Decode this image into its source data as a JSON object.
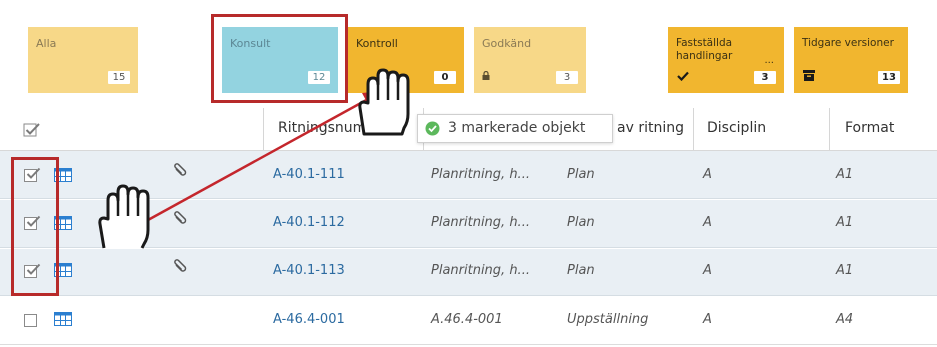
{
  "tiles": {
    "alla": {
      "label": "Alla",
      "count": "15"
    },
    "konsult": {
      "label": "Konsult",
      "count": "12"
    },
    "kontroll": {
      "label": "Kontroll",
      "count": "0"
    },
    "godkand": {
      "label": "Godkänd",
      "count": "3"
    },
    "faststallda": {
      "label": "Fastställda handlingar",
      "more": "...",
      "count": "3"
    },
    "tidigare": {
      "label": "Tidgare versioner",
      "count": "13"
    }
  },
  "tooltip": {
    "text": "3 markerade objekt"
  },
  "table": {
    "headers": [
      "Ritningsnumm...",
      "av ritning",
      "Disciplin",
      "Format"
    ],
    "rows": [
      {
        "checked": true,
        "number": "A-40.1-111",
        "description": "Planritning, h...",
        "type": "Plan",
        "discipline": "A",
        "format": "A1"
      },
      {
        "checked": true,
        "number": "A-40.1-112",
        "description": "Planritning, h...",
        "type": "Plan",
        "discipline": "A",
        "format": "A1"
      },
      {
        "checked": true,
        "number": "A-40.1-113",
        "description": "Planritning, h...",
        "type": "Plan",
        "discipline": "A",
        "format": "A1"
      },
      {
        "checked": false,
        "number": "A-46.4-001",
        "description": "A.46.4-001",
        "type": "Uppställning",
        "discipline": "A",
        "format": "A4"
      }
    ]
  },
  "colors": {
    "highlight": "#b72a2a",
    "link": "#2b6aa0",
    "tile_strong": "#f1b62f",
    "tile_light": "#f7d888",
    "tile_blue": "#93d3e0"
  }
}
